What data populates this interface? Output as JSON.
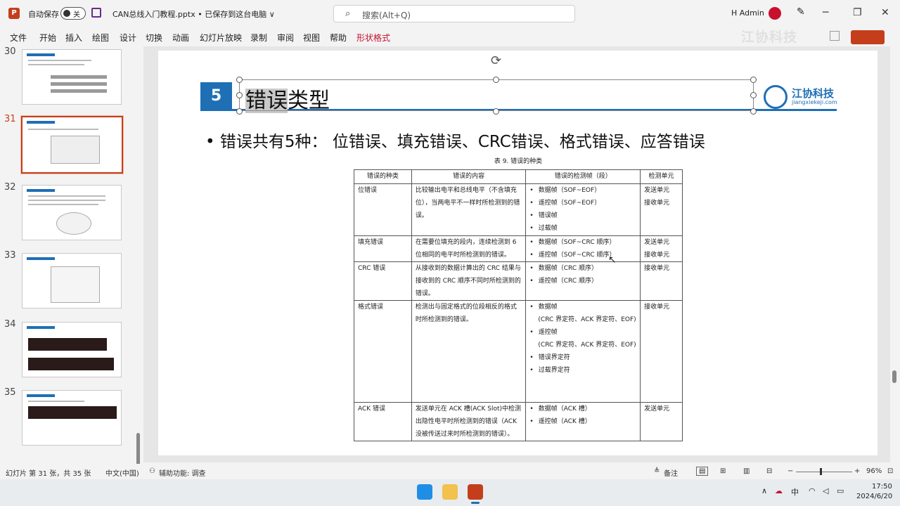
{
  "titlebar": {
    "autosave_label": "自动保存",
    "toggle_state": "关",
    "doc_title": "CAN总线入门教程.pptx • 已保存到这台电脑 ∨",
    "search_placeholder": "搜索(Alt+Q)",
    "user_name": "H Admin"
  },
  "menu": [
    "文件",
    "开始",
    "插入",
    "绘图",
    "设计",
    "切换",
    "动画",
    "幻灯片放映",
    "录制",
    "审阅",
    "视图",
    "帮助",
    "形状格式"
  ],
  "watermark": "江协科技",
  "thumbnails": [
    {
      "num": "30"
    },
    {
      "num": "31"
    },
    {
      "num": "32"
    },
    {
      "num": "33"
    },
    {
      "num": "34"
    },
    {
      "num": "35"
    }
  ],
  "slide": {
    "number": "5",
    "title_hl": "错误",
    "title_rest": "类型",
    "logo_name": "江协科技",
    "logo_url": "jiangxiekeji.com",
    "bullet": "•  错误共有5种：  位错误、填充错误、CRC错误、格式错误、应答错误",
    "table_caption": "表 9.   错误的种类",
    "table_headers": [
      "错误的种类",
      "错误的内容",
      "错误的检测帧（段）",
      "检测单元"
    ],
    "rows": [
      {
        "type": "位错误",
        "content": "比较输出电平和总线电平（不含填充位），当两电平不一样时所检测到的错误。",
        "frames": [
          "数据帧（SOF~EOF）",
          "遥控帧（SOF~EOF）",
          "错误帧",
          "过载帧"
        ],
        "units": [
          "发送单元",
          "接收单元"
        ]
      },
      {
        "type": "填充错误",
        "content": "在需要位填充的段内，连续检测到 6 位相同的电平时所检测到的错误。",
        "frames": [
          "数据帧（SOF~CRC 顺序）",
          "遥控帧（SOF~CRC 顺序）"
        ],
        "units": [
          "发送单元",
          "接收单元"
        ]
      },
      {
        "type": "CRC 错误",
        "content": "从接收到的数据计算出的 CRC 结果与接收到的 CRC 顺序不同时所检测到的错误。",
        "frames": [
          "数据帧（CRC 顺序）",
          "遥控帧（CRC 顺序）"
        ],
        "units": [
          "接收单元"
        ]
      },
      {
        "type": "格式错误",
        "content": "检测出与固定格式的位段相反的格式时所检测到的错误。",
        "frames": [
          "数据帧",
          "(CRC 界定符、ACK 界定符、EOF)",
          "遥控帧",
          "(CRC 界定符、ACK 界定符、EOF)",
          "错误界定符",
          "过载界定符"
        ],
        "units": [
          "接收单元"
        ]
      },
      {
        "type": "ACK 错误",
        "content": "发送单元在 ACK 槽(ACK Slot)中检测出隐性电平时所检测到的错误（ACK 没被传送过来时所检测到的错误）。",
        "frames": [
          "数据帧（ACK 槽）",
          "遥控帧（ACK 槽）"
        ],
        "units": [
          "发送单元"
        ]
      }
    ]
  },
  "status": {
    "slide_info": "幻灯片 第 31 张，共 35 张",
    "language": "中文(中国)",
    "accessibility": "辅助功能: 调查",
    "notes": "备注",
    "zoom": "96%"
  },
  "taskbar": {
    "ime": "中",
    "time": "17:50",
    "date": "2024/6/20"
  }
}
